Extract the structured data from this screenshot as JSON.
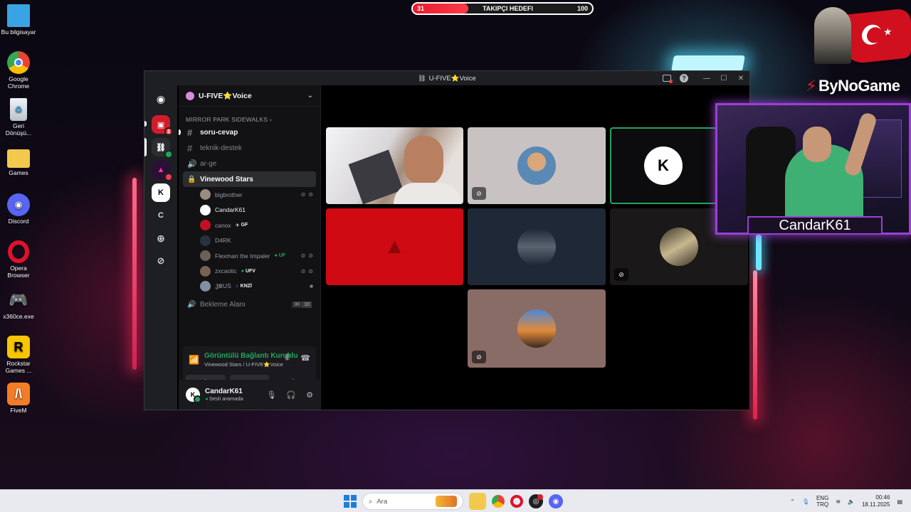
{
  "desktop_icons": [
    {
      "label": "Bu bilgisayar",
      "icon": "computer-icon",
      "color": "#3aa3e3"
    },
    {
      "label": "Google Chrome",
      "icon": "chrome-icon",
      "color": "#ea4335"
    },
    {
      "label": "Geri Dönüşü...",
      "icon": "recycle-bin-icon",
      "color": "#d6dde6"
    },
    {
      "label": "Games",
      "icon": "folder-icon",
      "color": "#f2c94c"
    },
    {
      "label": "Discord",
      "icon": "discord-icon",
      "color": "#5865f2"
    },
    {
      "label": "Opera Browser",
      "icon": "opera-icon",
      "color": "#e0112b"
    },
    {
      "label": "x360ce.exe",
      "icon": "gamepad-icon",
      "color": "#c8cdd4"
    },
    {
      "label": "Rockstar Games ...",
      "icon": "rockstar-icon",
      "color": "#f7c600"
    },
    {
      "label": "FiveM",
      "icon": "fivem-icon",
      "color": "#f27d26"
    }
  ],
  "follower_goal": {
    "current": "31",
    "title": "TAKIPÇI HEDEFI",
    "target": "100",
    "progress": 0.31
  },
  "webcam": {
    "name": "CandarK61"
  },
  "brand": {
    "name": "ByNoGame"
  },
  "discord": {
    "window_title": "U-FIVE⭐Voice",
    "server_name": "U-FIVE⭐Voice",
    "category": "MIRROR PARK SIDEWALKS",
    "channels": [
      {
        "name": "soru-cevap",
        "type": "text",
        "state": "unread"
      },
      {
        "name": "teknik-destek",
        "type": "text",
        "state": "normal"
      },
      {
        "name": "ar-ge",
        "type": "voice",
        "state": "normal"
      }
    ],
    "active_channel": "Vinewood Stars",
    "voice_users": [
      {
        "name": "bigbrother",
        "tag": "",
        "icons": "mute deafen"
      },
      {
        "name": "CandarK61",
        "tag": "",
        "icons": ""
      },
      {
        "name": "canox",
        "tag": "GF",
        "icons": ""
      },
      {
        "name": "D4RK",
        "tag": "",
        "icons": ""
      },
      {
        "name": "Flexman the Impaler",
        "tag": "UF",
        "icons": "mute deafen"
      },
      {
        "name": "zxcaotic",
        "tag": "UFV",
        "icons": "mute deafen"
      },
      {
        "name": "𝖅𝕰US",
        "tag": "KNZİ",
        "icons": "video"
      }
    ],
    "waiting_channel": {
      "name": "Bekleme Alanı",
      "count_left": "00",
      "count_right": "10"
    },
    "connection": {
      "status": "Görüntülü Bağlantı Kuruldu",
      "location": "Vinewood Stars / U-FIVE⭐Voice"
    },
    "user": {
      "name": "CandarK61",
      "status": "Sesli aramada"
    },
    "server_badges": {
      "first": "2",
      "third": "1"
    },
    "server_letter": "C"
  },
  "taskbar": {
    "search_placeholder": "Ara",
    "lang_top": "ENG",
    "lang_bottom": "TRQ",
    "time": "00:46",
    "date": "18.11.2025"
  }
}
